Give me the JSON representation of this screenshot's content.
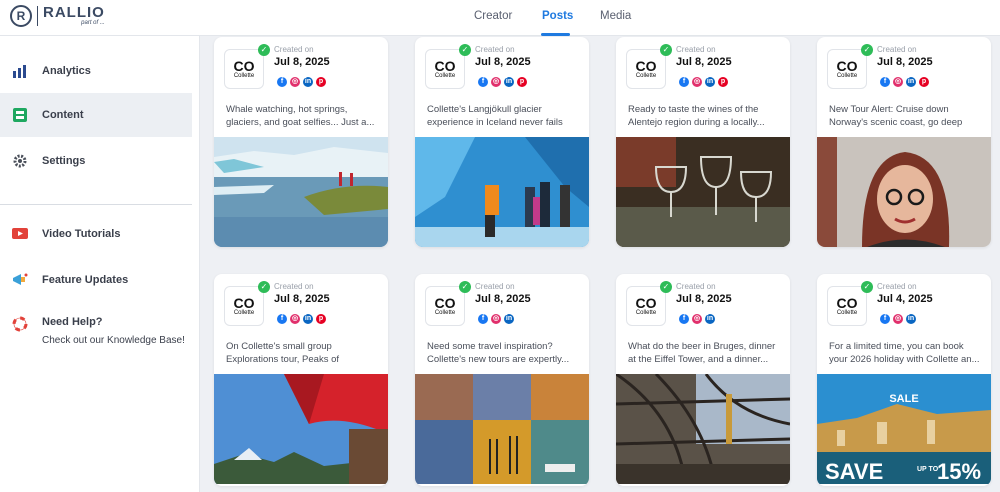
{
  "app": {
    "logo_letter": "R",
    "logo_text": "RALLIO",
    "logo_sub": "part of ...",
    "accent": "#1f7ae0"
  },
  "tabs": [
    {
      "label": "Creator"
    },
    {
      "label": "Posts",
      "active": true
    },
    {
      "label": "Media"
    }
  ],
  "sidebar": {
    "items": [
      {
        "label": "Analytics",
        "icon": "analytics-icon"
      },
      {
        "label": "Content",
        "icon": "content-icon",
        "active": true
      },
      {
        "label": "Settings",
        "icon": "gear-icon"
      }
    ],
    "secondary": [
      {
        "label": "Video Tutorials",
        "icon": "video-icon"
      },
      {
        "label": "Feature Updates",
        "icon": "megaphone-icon"
      },
      {
        "label": "Need Help?",
        "sub": "Check out our Knowledge Base!",
        "icon": "lifebuoy-icon"
      }
    ]
  },
  "brand": {
    "avatar_text": "CO",
    "avatar_name": "Collette"
  },
  "posts": [
    {
      "created_label": "Created on",
      "date": "Jul 8, 2025",
      "socials": [
        "facebook",
        "instagram",
        "linkedin",
        "pinterest"
      ],
      "caption": "Whale watching, hot springs, glaciers, and goat selfies... Just a...",
      "image": "glacier-lake"
    },
    {
      "created_label": "Created on",
      "date": "Jul 8, 2025",
      "socials": [
        "facebook",
        "instagram",
        "linkedin",
        "pinterest"
      ],
      "caption": "Collette's Langjökull glacier experience in Iceland never fails to...",
      "image": "ice-cave"
    },
    {
      "created_label": "Created on",
      "date": "Jul 8, 2025",
      "socials": [
        "facebook",
        "instagram",
        "linkedin",
        "pinterest"
      ],
      "caption": "Ready to taste the wines of the Alentejo region during a locally...",
      "image": "wine-glasses"
    },
    {
      "created_label": "Created on",
      "date": "Jul 8, 2025",
      "socials": [
        "facebook",
        "instagram",
        "linkedin",
        "pinterest"
      ],
      "caption": "New Tour Alert: Cruise down Norway's scenic coast, go deep int...",
      "image": "woman-portrait"
    },
    {
      "created_label": "Created on",
      "date": "Jul 8, 2025",
      "socials": [
        "facebook",
        "instagram",
        "linkedin",
        "pinterest"
      ],
      "caption": "On Collette's small group Explorations tour, Peaks of Europe,...",
      "image": "red-umbrella"
    },
    {
      "created_label": "Created on",
      "date": "Jul 8, 2025",
      "socials": [
        "facebook",
        "instagram",
        "linkedin"
      ],
      "caption": "Need some travel inspiration? Collette's new tours are expertly...",
      "image": "travel-collage"
    },
    {
      "created_label": "Created on",
      "date": "Jul 8, 2025",
      "socials": [
        "facebook",
        "instagram",
        "linkedin"
      ],
      "caption": "What do the beer in Bruges, dinner at the Eiffel Tower, and a dinner...",
      "image": "eiffel-interior"
    },
    {
      "created_label": "Created on",
      "date": "Jul 4, 2025",
      "socials": [
        "facebook",
        "instagram",
        "linkedin"
      ],
      "caption": "For a limited time, you can book your 2026 holiday with Collette an...",
      "image": "sale-banner",
      "overlay": {
        "sale": "SALE",
        "save": "SAVE",
        "up_to": "UP TO",
        "percent": "15%"
      }
    }
  ]
}
